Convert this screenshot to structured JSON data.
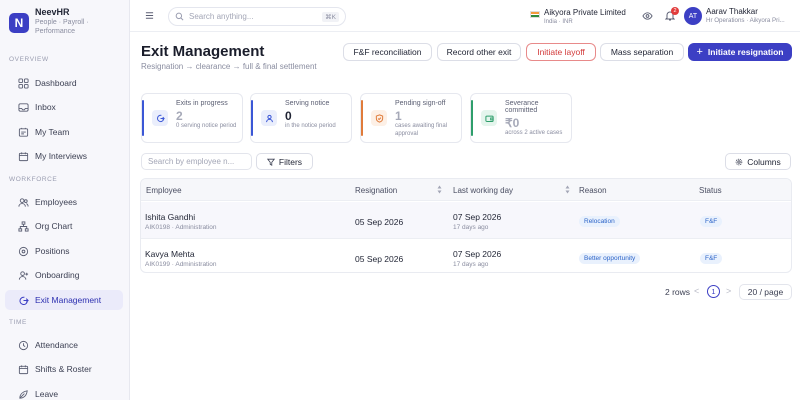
{
  "brand": {
    "name": "NeevHR",
    "tagline": "People · Payroll · Performance",
    "logo_letter": "N"
  },
  "sidebar": {
    "sections": [
      {
        "label": "OVERVIEW"
      },
      {
        "label": "WORKFORCE"
      },
      {
        "label": "TIME"
      }
    ],
    "items": [
      {
        "label": "Dashboard",
        "icon": "grid-icon"
      },
      {
        "label": "Inbox",
        "icon": "inbox-icon"
      },
      {
        "label": "My Team",
        "icon": "team-icon"
      },
      {
        "label": "My Interviews",
        "icon": "calendar-icon"
      },
      {
        "label": "Employees",
        "icon": "users-icon"
      },
      {
        "label": "Org Chart",
        "icon": "org-chart-icon"
      },
      {
        "label": "Positions",
        "icon": "briefcase-icon"
      },
      {
        "label": "Onboarding",
        "icon": "user-plus-icon"
      },
      {
        "label": "Exit Management",
        "icon": "exit-icon",
        "active": true
      },
      {
        "label": "Attendance",
        "icon": "clock-icon"
      },
      {
        "label": "Shifts & Roster",
        "icon": "calendar-icon"
      },
      {
        "label": "Leave",
        "icon": "leave-icon"
      }
    ]
  },
  "topbar": {
    "search_placeholder": "Search anything...",
    "shortcut": "⌘K",
    "org": {
      "name": "Aikyora Private Limited",
      "sub": "India · INR"
    },
    "notifications": "2",
    "user": {
      "initials": "AT",
      "name": "Aarav Thakkar",
      "role": "Hr Operations · Aikyora Pri..."
    }
  },
  "page": {
    "title": "Exit Management",
    "subtitle": "Resignation → clearance → full & final settlement",
    "actions": {
      "fnf": "F&F reconciliation",
      "other_exit": "Record other exit",
      "layoff": "Initiate layoff",
      "mass": "Mass separation",
      "resign": "Initiate resignation"
    }
  },
  "stats": [
    {
      "label": "Exits in progress",
      "value": "2",
      "sub": "0 serving notice period",
      "color": "#3b57d6"
    },
    {
      "label": "Serving notice",
      "value": "0",
      "sub": "in the notice period",
      "color": "#3b57d6"
    },
    {
      "label": "Pending sign-off",
      "value": "1",
      "sub": "cases awaiting final approval",
      "color": "#e07b3a"
    },
    {
      "label": "Severance committed",
      "value": "₹0",
      "sub": "across 2 active cases",
      "color": "#2e9e6b"
    }
  ],
  "toolbar": {
    "search_placeholder": "Search by employee n...",
    "filters": "Filters",
    "columns": "Columns"
  },
  "table": {
    "headers": {
      "employee": "Employee",
      "resignation": "Resignation",
      "lwd": "Last working day",
      "reason": "Reason",
      "status": "Status"
    },
    "rows": [
      {
        "name": "Ishita Gandhi",
        "meta": "AIK0198 · Administration",
        "resignation": "05 Sep 2026",
        "lwd": "07 Sep 2026",
        "ago": "17 days ago",
        "reason": "Relocation",
        "status": "F&F"
      },
      {
        "name": "Kavya Mehta",
        "meta": "AIK0199 · Administration",
        "resignation": "05 Sep 2026",
        "lwd": "07 Sep 2026",
        "ago": "17 days ago",
        "reason": "Better opportunity",
        "status": "F&F"
      }
    ]
  },
  "pagination": {
    "rows": "2 rows",
    "prev": "<",
    "page": "1",
    "next": ">",
    "per_page": "20 / page"
  }
}
